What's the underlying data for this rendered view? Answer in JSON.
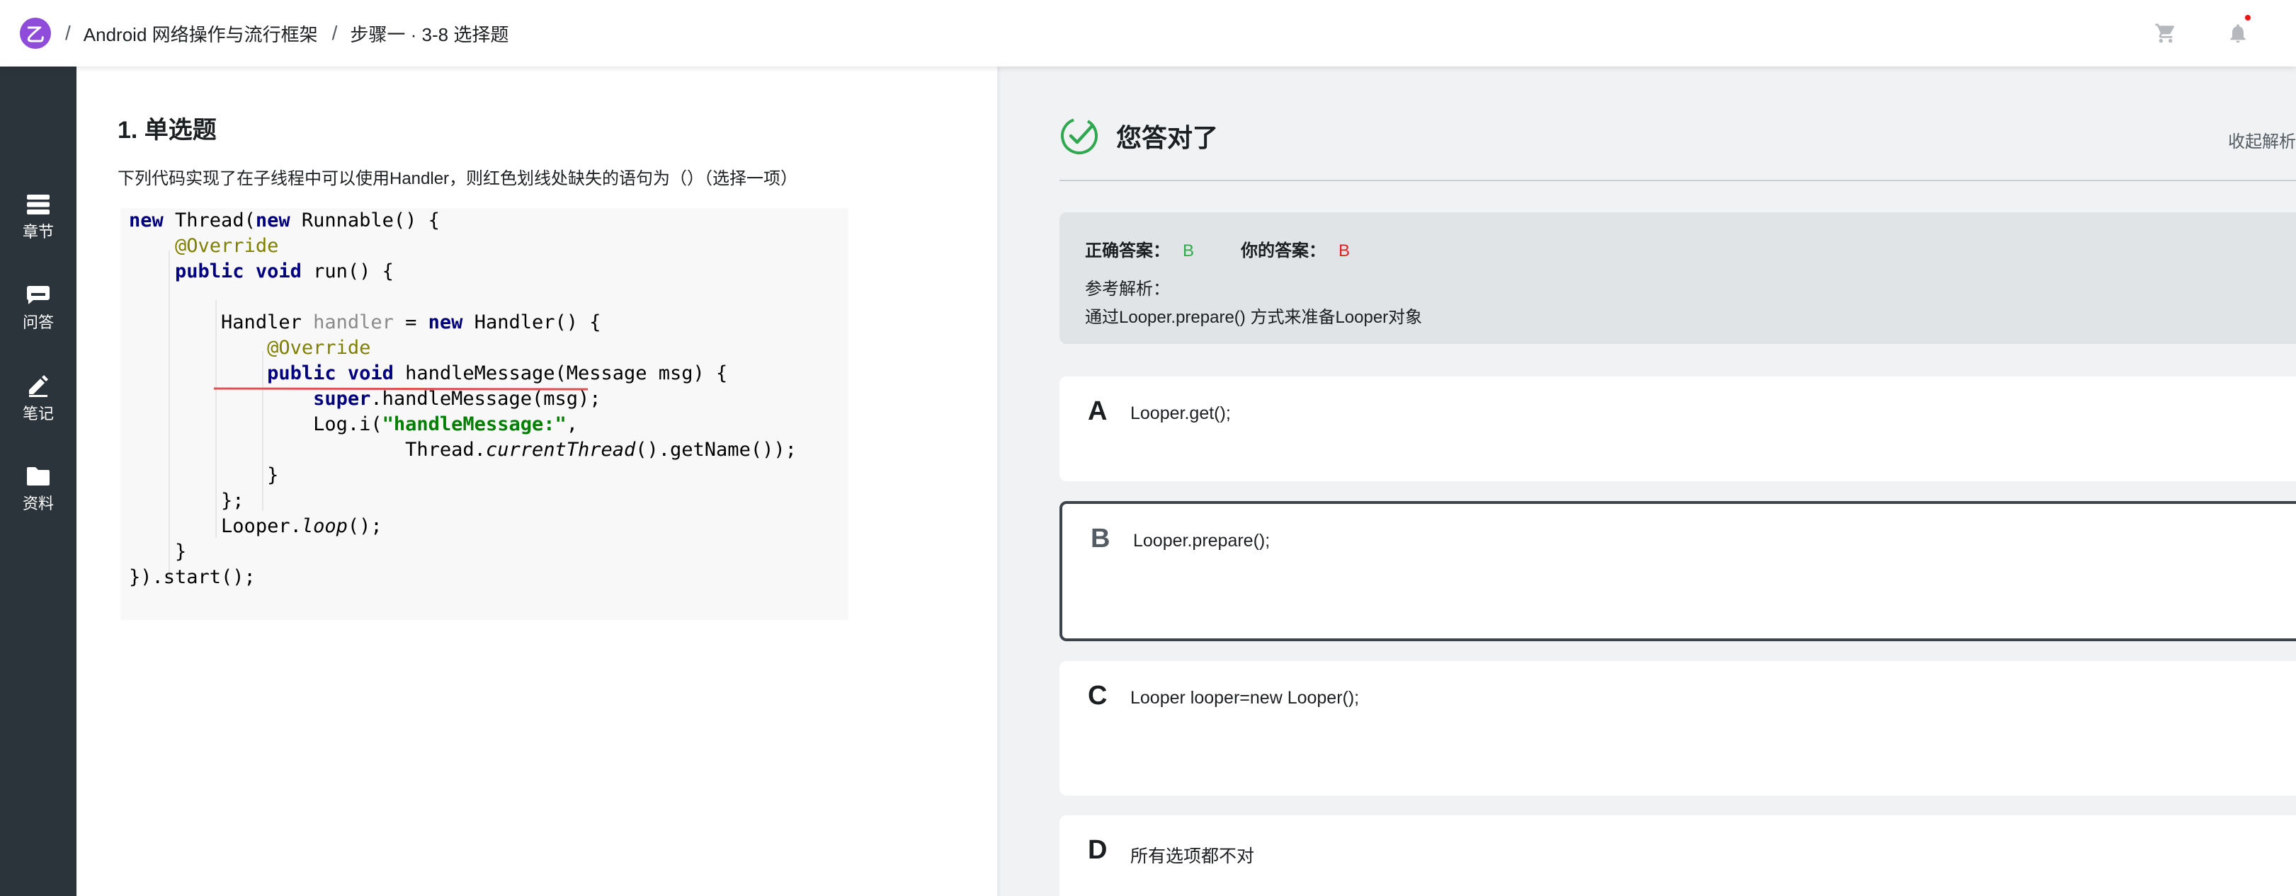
{
  "header": {
    "crumbs": [
      "Android 网络操作与流行框架",
      "步骤一 · 3-8 选择题"
    ],
    "separator": "/",
    "logo_glyph": "乙",
    "icons": [
      "cart-icon",
      "bell-icon"
    ]
  },
  "sidebar": {
    "items": [
      {
        "label": "章节",
        "icon": "chapter-icon"
      },
      {
        "label": "问答",
        "icon": "qa-icon"
      },
      {
        "label": "笔记",
        "icon": "pencil-icon"
      },
      {
        "label": "资料",
        "icon": "folder-icon"
      }
    ]
  },
  "question": {
    "title": "1. 单选题",
    "description": "下列代码实现了在子线程中可以使用Handler，则红色划线处缺失的语句为（）（选择一项）",
    "code": {
      "l1_kw1": "new",
      "l1_t1": " Thread(",
      "l1_kw2": "new",
      "l1_t2": " Runnable() {",
      "l2_ann": "@Override",
      "l3_kw": "public void",
      "l3_t": " run() {",
      "l5_t1": "Handler ",
      "l5_var": "handler",
      "l5_t2": " = ",
      "l5_kw": "new",
      "l5_t3": " Handler() {",
      "l6_ann": "@Override",
      "l7_kw": "public void",
      "l7_t": " handleMessage(Message msg) {",
      "l8_kw": "super",
      "l8_t": ".handleMessage(msg);",
      "l9_t1": "Log.i(",
      "l9_str": "\"handleMessage:\"",
      "l9_t2": ",",
      "l10_t1": "Thread.",
      "l10_it": "currentThread",
      "l10_t2": "().getName());",
      "l11_t": "}",
      "l12_t": "};",
      "l13_t1": "Looper.",
      "l13_it": "loop",
      "l13_t2": "();",
      "l14_t": "}",
      "l15_t": "}).start();"
    }
  },
  "result": {
    "status": "您答对了",
    "collapse_label": "收起解析",
    "correct_label": "正确答案：",
    "correct_value": "B",
    "yours_label": "你的答案：",
    "yours_value": "B",
    "reference_label": "参考解析：",
    "reference_text": "通过Looper.prepare() 方式来准备Looper对象",
    "colors": {
      "correct": "#2fa84f",
      "yours": "#e02020",
      "check": "#2fa84f"
    }
  },
  "options": [
    {
      "letter": "A",
      "text": "Looper.get();"
    },
    {
      "letter": "B",
      "text": "Looper.prepare();",
      "selected": true
    },
    {
      "letter": "C",
      "text": "Looper looper=new Looper();"
    },
    {
      "letter": "D",
      "text": "所有选项都不对"
    }
  ]
}
